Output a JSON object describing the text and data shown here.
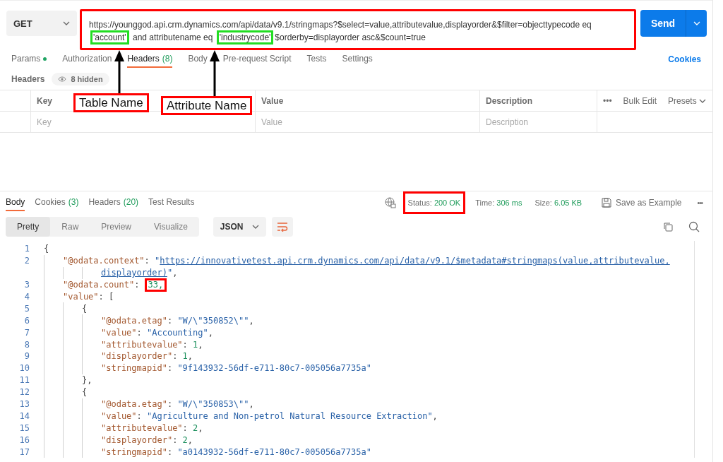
{
  "request": {
    "method": "GET",
    "url": {
      "framed": true,
      "segments": [
        {
          "text": "https://younggod.api.crm.dynamics.com/api/data/v9.1/stringmaps?$select=value,attributevalue,displayorder&$filter=objecttypecode eq ",
          "marked": false
        },
        {
          "text": "'account'",
          "marked": true
        },
        {
          "text": " and attributename eq ",
          "marked": false
        },
        {
          "text": "'industrycode'",
          "marked": true
        },
        {
          "text": "$orderby=displayorder asc&$count=true",
          "marked": false
        }
      ]
    },
    "send": "Send"
  },
  "request_tabs": [
    {
      "label": "Params",
      "dot": true,
      "selected": false
    },
    {
      "label": "Authorization",
      "dot": false,
      "selected": false
    },
    {
      "label": "Headers",
      "count": "(8)",
      "dot": false,
      "selected": true
    },
    {
      "label": "Body",
      "dot": false,
      "selected": false
    },
    {
      "label": "Pre-request Script",
      "dot": false,
      "selected": false
    },
    {
      "label": "Tests",
      "dot": false,
      "selected": false
    },
    {
      "label": "Settings",
      "dot": false,
      "selected": false
    }
  ],
  "cookies_link": "Cookies",
  "headers": {
    "title": "Headers",
    "hidden": "8 hidden",
    "columns": [
      "Key",
      "Value",
      "Description"
    ],
    "actions": [
      "•••",
      "Bulk Edit",
      "Presets"
    ],
    "placeholders": [
      "Key",
      "Value",
      "Description"
    ]
  },
  "annotations": [
    {
      "label": "Table Name"
    },
    {
      "label": "Attribute Name"
    }
  ],
  "response_tabs": [
    {
      "label": "Body",
      "selected": true
    },
    {
      "label": "Cookies",
      "count": "(3)",
      "selected": false
    },
    {
      "label": "Headers",
      "count": "(20)",
      "selected": false
    },
    {
      "label": "Test Results",
      "selected": false
    }
  ],
  "response_stats": [
    {
      "label": "Status:",
      "value": "200 OK",
      "framed": true
    },
    {
      "label": "Time:",
      "value": "306 ms",
      "framed": false
    },
    {
      "label": "Size:",
      "value": "6.05 KB",
      "framed": false
    }
  ],
  "save_example": "Save as Example",
  "more": "•••",
  "view_modes": [
    {
      "label": "Pretty",
      "selected": true
    },
    {
      "label": "Raw",
      "selected": false
    },
    {
      "label": "Preview",
      "selected": false
    },
    {
      "label": "Visualize",
      "selected": false
    }
  ],
  "format": "JSON",
  "code_lines": [
    {
      "number": "1",
      "tokens": [
        {
          "kind": "punct",
          "text": "{"
        }
      ]
    },
    {
      "number": "2",
      "tokens": [
        {
          "kind": "key",
          "text": "\"@odata.context\""
        },
        {
          "kind": "punct",
          "text": ": "
        },
        {
          "kind": "str",
          "text": "\""
        },
        {
          "kind": "link",
          "text": "https://innovativetest.api.crm.dynamics.com/api/data/v9.1/$metadata#stringmaps(value,attributevalue,"
        }
      ],
      "wrap_tokens": [
        {
          "kind": "link",
          "text": "displayorder)"
        },
        {
          "kind": "str",
          "text": "\""
        },
        {
          "kind": "punct",
          "text": ","
        }
      ]
    },
    {
      "number": "3",
      "tokens": [
        {
          "kind": "key",
          "text": "\"@odata.count\""
        },
        {
          "kind": "punct",
          "text": ": "
        },
        {
          "kind": "num",
          "text": "33,",
          "framed": true
        }
      ]
    },
    {
      "number": "4",
      "tokens": [
        {
          "kind": "key",
          "text": "\"value\""
        },
        {
          "kind": "punct",
          "text": ": ["
        }
      ]
    },
    {
      "number": "5",
      "tokens": [
        {
          "kind": "punct",
          "text": "{"
        }
      ]
    },
    {
      "number": "6",
      "tokens": [
        {
          "kind": "key",
          "text": "\"@odata.etag\""
        },
        {
          "kind": "punct",
          "text": ": "
        },
        {
          "kind": "str",
          "text": "\"W/\\\"350852\\\"\""
        },
        {
          "kind": "punct",
          "text": ","
        }
      ]
    },
    {
      "number": "7",
      "tokens": [
        {
          "kind": "key",
          "text": "\"value\""
        },
        {
          "kind": "punct",
          "text": ": "
        },
        {
          "kind": "str",
          "text": "\"Accounting\""
        },
        {
          "kind": "punct",
          "text": ","
        }
      ]
    },
    {
      "number": "8",
      "tokens": [
        {
          "kind": "key",
          "text": "\"attributevalue\""
        },
        {
          "kind": "punct",
          "text": ": "
        },
        {
          "kind": "num",
          "text": "1"
        },
        {
          "kind": "punct",
          "text": ","
        }
      ]
    },
    {
      "number": "9",
      "tokens": [
        {
          "kind": "key",
          "text": "\"displayorder\""
        },
        {
          "kind": "punct",
          "text": ": "
        },
        {
          "kind": "num",
          "text": "1"
        },
        {
          "kind": "punct",
          "text": ","
        }
      ]
    },
    {
      "number": "10",
      "tokens": [
        {
          "kind": "key",
          "text": "\"stringmapid\""
        },
        {
          "kind": "punct",
          "text": ": "
        },
        {
          "kind": "str",
          "text": "\"9f143932-56df-e711-80c7-005056a7735a\""
        }
      ]
    },
    {
      "number": "11",
      "tokens": [
        {
          "kind": "punct",
          "text": "},"
        }
      ]
    },
    {
      "number": "12",
      "tokens": [
        {
          "kind": "punct",
          "text": "{"
        }
      ]
    },
    {
      "number": "13",
      "tokens": [
        {
          "kind": "key",
          "text": "\"@odata.etag\""
        },
        {
          "kind": "punct",
          "text": ": "
        },
        {
          "kind": "str",
          "text": "\"W/\\\"350853\\\"\""
        },
        {
          "kind": "punct",
          "text": ","
        }
      ]
    },
    {
      "number": "14",
      "tokens": [
        {
          "kind": "key",
          "text": "\"value\""
        },
        {
          "kind": "punct",
          "text": ": "
        },
        {
          "kind": "str",
          "text": "\"Agriculture and Non-petrol Natural Resource Extraction\""
        },
        {
          "kind": "punct",
          "text": ","
        }
      ]
    },
    {
      "number": "15",
      "tokens": [
        {
          "kind": "key",
          "text": "\"attributevalue\""
        },
        {
          "kind": "punct",
          "text": ": "
        },
        {
          "kind": "num",
          "text": "2"
        },
        {
          "kind": "punct",
          "text": ","
        }
      ]
    },
    {
      "number": "16",
      "tokens": [
        {
          "kind": "key",
          "text": "\"displayorder\""
        },
        {
          "kind": "punct",
          "text": ": "
        },
        {
          "kind": "num",
          "text": "2"
        },
        {
          "kind": "punct",
          "text": ","
        }
      ]
    },
    {
      "number": "17",
      "tokens": [
        {
          "kind": "key",
          "text": "\"stringmapid\""
        },
        {
          "kind": "punct",
          "text": ": "
        },
        {
          "kind": "str",
          "text": "\"a0143932-56df-e711-80c7-005056a7735a\""
        }
      ]
    }
  ]
}
